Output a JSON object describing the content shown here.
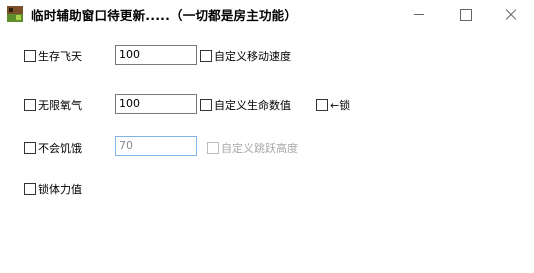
{
  "window": {
    "title": "临时辅助窗口待更新.....（一切都是房主功能）",
    "icon": "minecraft-grass-block-icon",
    "controls": [
      "minimize",
      "maximize",
      "close"
    ]
  },
  "rows": [
    {
      "checkbox_label": "生存飞天",
      "checked": false,
      "input_value": "100",
      "option_label": "自定义移动速度",
      "option_checked": false
    },
    {
      "checkbox_label": "无限氧气",
      "checked": false,
      "input_value": "100",
      "option_label": "自定义生命数值",
      "option_checked": false,
      "lock_label": "←锁",
      "lock_checked": false
    },
    {
      "checkbox_label": "不会饥饿",
      "checked": false,
      "input_value": "70",
      "input_disabled": true,
      "option_label": "自定义跳跃高度",
      "option_checked": false,
      "option_disabled": true
    },
    {
      "checkbox_label": "锁体力值",
      "checked": false
    }
  ],
  "colors": {
    "input_border": "#7a7a7a",
    "disabled_input_border": "#7eb4ea",
    "disabled_text": "#a8a8a8"
  }
}
